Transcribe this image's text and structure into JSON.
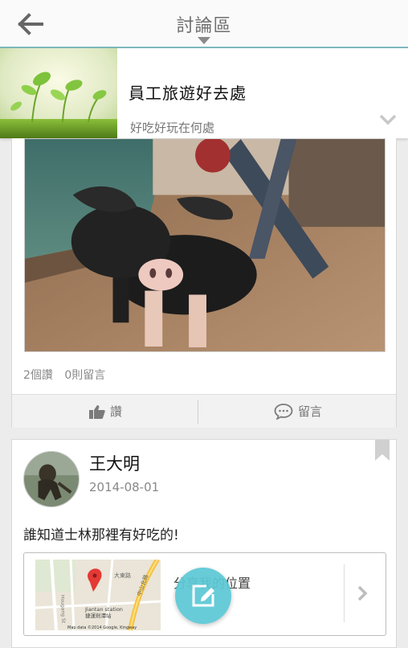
{
  "header": {
    "title": "討論區",
    "back_icon": "arrow-left-icon",
    "caret_icon": "caret-down-icon"
  },
  "group": {
    "name": "員工旅遊好去處",
    "subtitle": "好吃好玩在何處",
    "thumbnail": "sprout-photo",
    "expand_icon": "chevron-down-icon"
  },
  "post1": {
    "image": "pig-figurine-photo",
    "reads": "2個讚",
    "comments": "0則留言",
    "like_label": "讚",
    "comment_label": "留言",
    "like_icon": "thumbs-up-icon",
    "comment_icon": "speech-bubble-icon"
  },
  "post2": {
    "author": "王大明",
    "date": "2014-08-01",
    "text": "誰知道士林那裡有好吃的!",
    "location_label": "分享我的位置",
    "map": {
      "roads": [
        "大東路",
        "中山北路",
        "Jiantan station",
        "捷運劍潭站",
        "Hougang St"
      ],
      "attribution": "Map data ©2014 Google, Kingway",
      "pin_color": "#e53935"
    },
    "bookmark_icon": "bookmark-icon",
    "arrow_icon": "chevron-right-icon"
  },
  "fab": {
    "icon": "compose-pencil-icon",
    "color": "#5cc9d6"
  },
  "colors": {
    "accent": "#7fb7bd",
    "fab": "#5cc9d6"
  }
}
